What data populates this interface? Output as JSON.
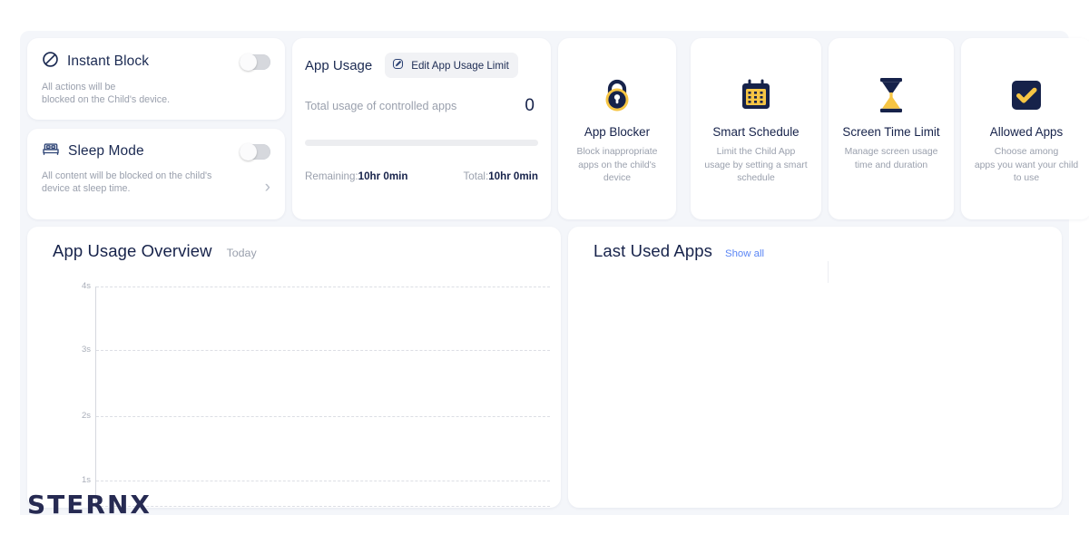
{
  "brand": {
    "name": "STERNX",
    "accent_navy": "#16224a",
    "accent_yellow": "#f6c544",
    "link_blue": "#5b86f5"
  },
  "toggles": [
    {
      "icon": "prohibition-icon",
      "title": "Instant Block",
      "description": "All actions will be\nblocked on the Child's device.",
      "desc_line1": "All actions will be",
      "desc_line2": "blocked on the Child's device.",
      "state": "off",
      "has_chevron": false
    },
    {
      "icon": "bed-icon",
      "title": "Sleep Mode",
      "description": "All content will be blocked on the child's device at sleep time.",
      "desc_line1": "All content will be blocked on the child's",
      "desc_line2": "device at sleep time.",
      "state": "off",
      "has_chevron": true,
      "chevron": "›"
    }
  ],
  "app_usage": {
    "title": "App Usage",
    "edit_button": {
      "label": "Edit App Usage Limit",
      "icon": "edit-pencil-icon"
    },
    "total_label": "Total usage of controlled apps",
    "total_value": "0",
    "progress_percent": 0,
    "remaining_label": "Remaining:",
    "remaining_value": "10hr 0min",
    "total_time_label": "Total:",
    "total_time_value": "10hr 0min"
  },
  "features": [
    {
      "icon": "padlock-icon",
      "title": "App Blocker",
      "desc_line1": "Block inappropriate",
      "desc_line2": "apps on the child's device"
    },
    {
      "icon": "calendar-icon",
      "title": "Smart Schedule",
      "desc_line1": "Limit the Child App",
      "desc_line2": "usage by setting a smart",
      "desc_line3": "schedule"
    },
    {
      "icon": "hourglass-icon",
      "title": "Screen Time Limit",
      "desc_line1": "Manage screen usage",
      "desc_line2": "time and duration"
    },
    {
      "icon": "checkbox-checked-icon",
      "title": "Allowed Apps",
      "desc_line1": "Choose among",
      "desc_line2": "apps you want your child",
      "desc_line3": "to use"
    }
  ],
  "usage_overview": {
    "title": "App Usage Overview",
    "subtitle": "Today"
  },
  "last_used_apps": {
    "title": "Last Used Apps",
    "show_all_label": "Show all",
    "items": []
  },
  "chart_data": {
    "type": "bar",
    "title": "App Usage Overview",
    "subtitle": "Today",
    "categories": [],
    "values": [],
    "series": [],
    "xlabel": "",
    "ylabel": "",
    "ylim": [
      0,
      4
    ],
    "yticks": [
      1,
      2,
      3,
      4
    ],
    "ytick_labels": [
      "1s",
      "2s",
      "3s",
      "4s"
    ],
    "grid": true,
    "grid_style": "dashed-horizontal",
    "legend": "none",
    "empty": true
  }
}
